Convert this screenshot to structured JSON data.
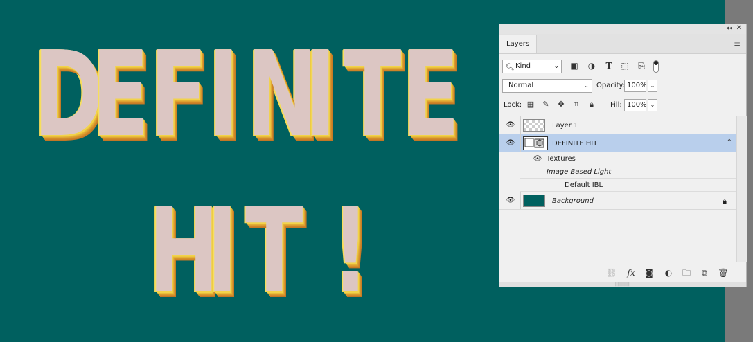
{
  "canvas": {
    "line1": [
      "D",
      "E",
      "F",
      "I",
      "N",
      "I",
      "T",
      "E"
    ],
    "line2": [
      "H",
      "I",
      "T",
      " ",
      "!"
    ],
    "background_color": "#00605f",
    "face_color": "#dcc6c3",
    "side_color": "#f2d34a",
    "shadow_color": "#c47725"
  },
  "panel": {
    "tab_label": "Layers",
    "collapse_icon": "double-chevron-left-icon",
    "close_icon": "close-icon",
    "menu_icon": "hamburger-menu-icon",
    "filter": {
      "kind_label": "Kind",
      "icons": [
        "image-filter-icon",
        "adjustment-filter-icon",
        "type-filter-icon",
        "shape-filter-icon",
        "smart-object-filter-icon"
      ]
    },
    "blend": {
      "mode": "Normal",
      "opacity_label": "Opacity:",
      "opacity_value": "100%"
    },
    "lock": {
      "label": "Lock:",
      "icons": [
        "lock-transparent-icon",
        "lock-paint-icon",
        "lock-position-icon",
        "lock-artboard-icon",
        "lock-all-icon"
      ],
      "fill_label": "Fill:",
      "fill_value": "100%"
    },
    "layers": [
      {
        "name": "Layer 1",
        "visible": true
      },
      {
        "name": "DEFINITE HIT !",
        "visible": true,
        "selected": true,
        "type": "3d"
      },
      {
        "name": "Background",
        "visible": true,
        "locked": true
      }
    ],
    "sublayers": {
      "textures": "Textures",
      "ibl": "Image Based Light",
      "default_ibl": "Default IBL"
    },
    "bottom_icons": [
      "link-layers-icon",
      "fx-icon",
      "layer-mask-icon",
      "adjustment-layer-icon",
      "new-group-icon",
      "new-layer-icon",
      "delete-icon"
    ],
    "fx_label": "fx"
  }
}
